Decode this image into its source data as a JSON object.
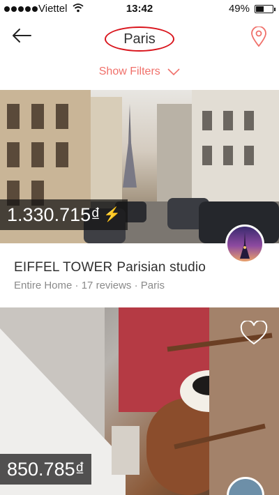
{
  "status_bar": {
    "carrier": "Viettel",
    "time": "13:42",
    "battery_percent": "49%",
    "battery_level": 0.49,
    "signal_icon": "signal-dots-icon",
    "wifi_icon": "wifi-icon"
  },
  "nav": {
    "title": "Paris",
    "back_icon": "arrow-left-icon",
    "map_icon": "map-pin-icon"
  },
  "filters": {
    "label": "Show Filters",
    "icon": "chevron-down-icon"
  },
  "listings": [
    {
      "price": "1.330.715₫",
      "instant_book_icon": "lightning-icon",
      "name_prefix": "EIFFEL TOWER",
      "name_suffix": "Parisian studio",
      "type": "Entire Home",
      "reviews": "17 reviews",
      "location": "Paris"
    },
    {
      "price": "850.785₫",
      "favorite_icon": "heart-icon"
    }
  ],
  "colors": {
    "accent": "#f0706a",
    "highlight_circle": "#d9141c",
    "bolt": "#f4b400"
  }
}
